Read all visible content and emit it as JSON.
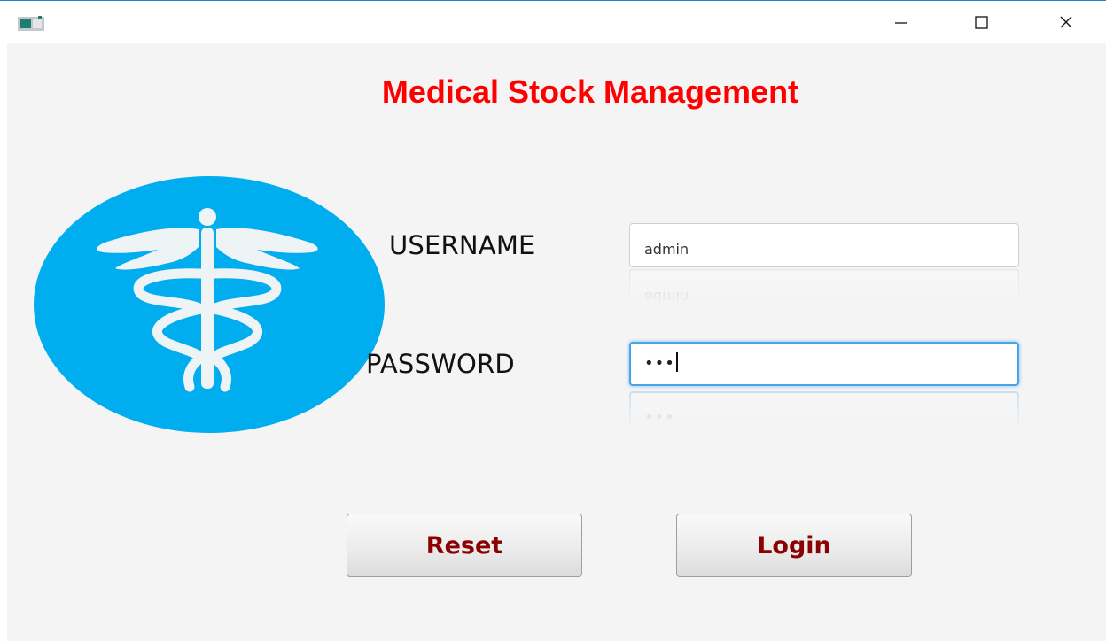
{
  "window": {
    "controls": {
      "minimize_icon": "minimize-icon",
      "maximize_icon": "maximize-icon",
      "close_icon": "close-icon"
    }
  },
  "main": {
    "title": "Medical Stock Management",
    "logo": {
      "icon": "caduceus-icon",
      "color": "#00adef"
    },
    "username": {
      "label": "USERNAME",
      "value": "admin"
    },
    "password": {
      "label": "PASSWORD",
      "masked_value": "•••"
    },
    "buttons": {
      "reset_label": "Reset",
      "login_label": "Login"
    }
  },
  "colors": {
    "title": "#ff0000",
    "button_text": "#8b0000",
    "focus_ring": "#43a6e8",
    "logo": "#00adef"
  }
}
